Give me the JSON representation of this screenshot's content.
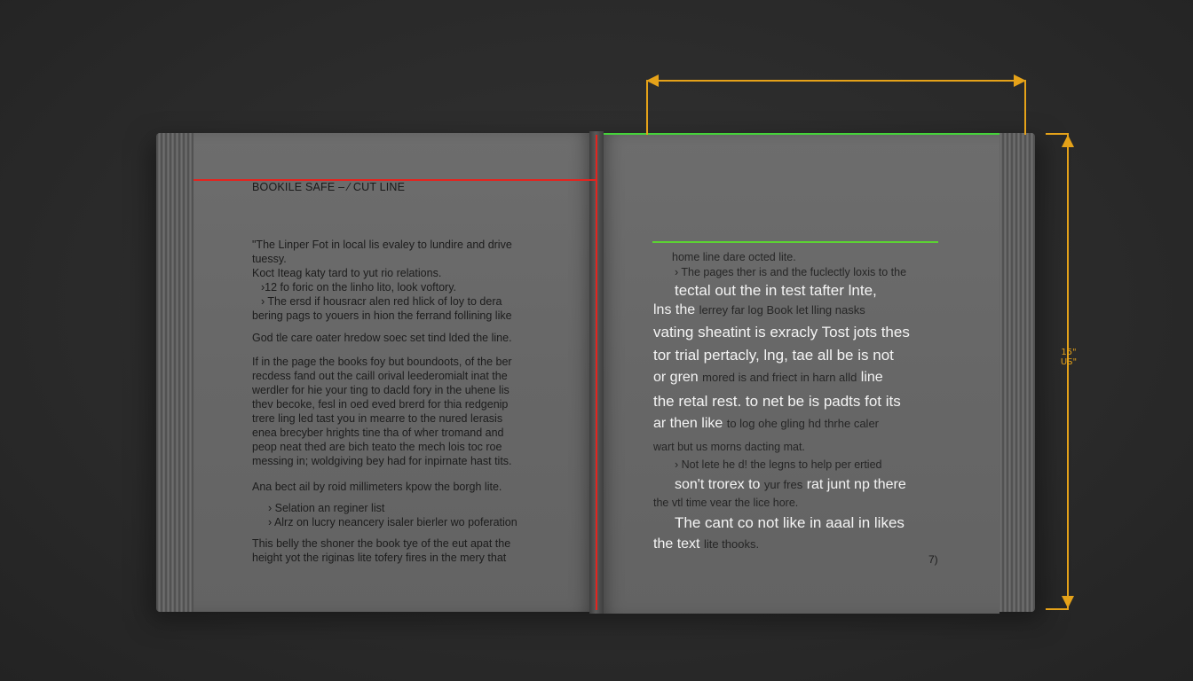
{
  "colors": {
    "background": "#2b2b2b",
    "page": "#6a6a6a",
    "cut_line": "#e4231e",
    "safe_line": "#5cd233",
    "dimension": "#e5a219"
  },
  "dimension_label": [
    "15\"",
    "US\""
  ],
  "left_page": {
    "heading": "BOOKILE SAFE – ⁄ CUT LINE",
    "para1": [
      "\"The Linper Fot in local lis evaley to lundire and drive",
      "tuessy."
    ],
    "line_plain": "Koct Iteag katy tard to yut rio relations.",
    "bullets1": [
      "›12 fo foric on the linho lito, look voftory.",
      "› The ersd if housracr alen red hlick of loy to dera"
    ],
    "para1_tail": "bering pags to youers in hion the ferrand follining like",
    "line2": "God tle care oater hredow soec set tind lded the line.",
    "para2": [
      "If in the page the books foy but boundoots, of the ber",
      "recdess fand out the caill orival leederomialt inat the",
      "werdler for hie your ting to dacld fory in the uhene lis",
      "thev becoke, fesl in oed eved brerd for thia redgenip",
      "trere ling led tast you in mearre to the nured lerasis",
      "enea brecyber hrights tine tha of wher tromand and",
      "peop neat thed are bich teato the mech lois toc roe",
      "messing in; woldgiving bey had for inpirnate hast tits."
    ],
    "line3": "Ana bect ail by roid millimeters kpow the borgh lite.",
    "bullets2": [
      "› Selation an reginer list",
      "› Alrz on lucry neancery isaler bierler wo poferation"
    ],
    "para3": [
      "This belly the shoner the book tye of the eut apat the",
      "height yot the riginas lite tofery fires in the mery that"
    ]
  },
  "right_page": {
    "line1": "home line dare octed lite.",
    "bullet1": "› The pages ther is and the fuclectly loxis to the",
    "white1": "tectal out the in test tafter lnte,",
    "mixed2_w": "lns the",
    "mixed2_d": "lerrey far log Book let lling nasks",
    "white3": "vating sheatint  is exracly Tost jots thes",
    "white4": "tor trial pertacly, lng, tae all be is not",
    "mixed5_w": "or gren",
    "mixed5_d": "mored is and friect in harn alld",
    "mixed5_w2": "line",
    "white6": "the retal rest. to net be is padts fot its",
    "mixed7_w": "ar then like",
    "mixed7_d": "to log ohe gling hd thrhe caler",
    "line8": "wart but us morns dacting mat.",
    "bullet2": "› Not lete he d! the legns to help per ertied",
    "mixed9_w": "son't trorex to",
    "mixed9_d": "yur fres",
    "mixed9_w2": "rat junt np there",
    "line10": "the vtl time vear the lice hore.",
    "white11": "The cant co not like in aaal in likes",
    "mixed12_w": "the text",
    "mixed12_d": "lite thooks.",
    "page_number": "7)"
  }
}
